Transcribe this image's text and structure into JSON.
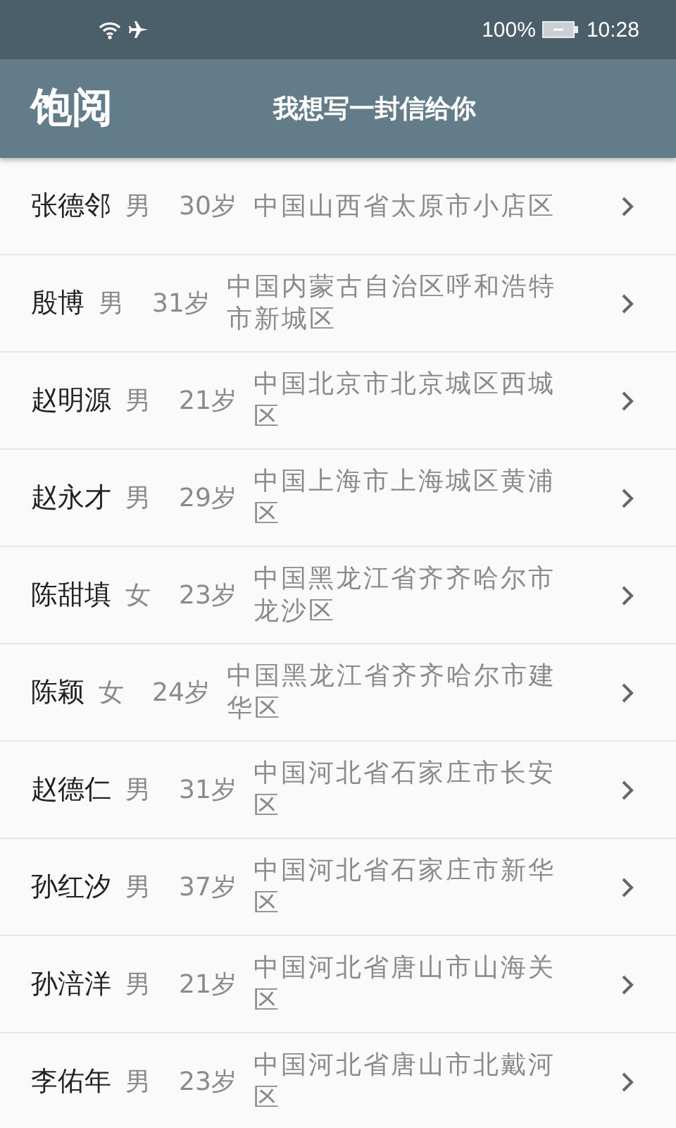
{
  "status_bar": {
    "battery": "100%",
    "time": "10:28"
  },
  "app_bar": {
    "logo": "饱阅",
    "title": "我想写一封信给你"
  },
  "people": [
    {
      "name": "张德邻",
      "gender": "男",
      "age": "30岁",
      "address": "中国山西省太原市小店区"
    },
    {
      "name": "殷博",
      "gender": "男",
      "age": "31岁",
      "address": "中国内蒙古自治区呼和浩特市新城区"
    },
    {
      "name": "赵明源",
      "gender": "男",
      "age": "21岁",
      "address": "中国北京市北京城区西城区"
    },
    {
      "name": "赵永才",
      "gender": "男",
      "age": "29岁",
      "address": "中国上海市上海城区黄浦区"
    },
    {
      "name": "陈甜填",
      "gender": "女",
      "age": "23岁",
      "address": "中国黑龙江省齐齐哈尔市龙沙区"
    },
    {
      "name": "陈颖",
      "gender": "女",
      "age": "24岁",
      "address": "中国黑龙江省齐齐哈尔市建华区"
    },
    {
      "name": "赵德仁",
      "gender": "男",
      "age": "31岁",
      "address": "中国河北省石家庄市长安区"
    },
    {
      "name": "孙红汐",
      "gender": "男",
      "age": "37岁",
      "address": "中国河北省石家庄市新华区"
    },
    {
      "name": "孙涪洋",
      "gender": "男",
      "age": "21岁",
      "address": "中国河北省唐山市山海关区"
    },
    {
      "name": "李佑年",
      "gender": "男",
      "age": "23岁",
      "address": "中国河北省唐山市北戴河区"
    }
  ]
}
